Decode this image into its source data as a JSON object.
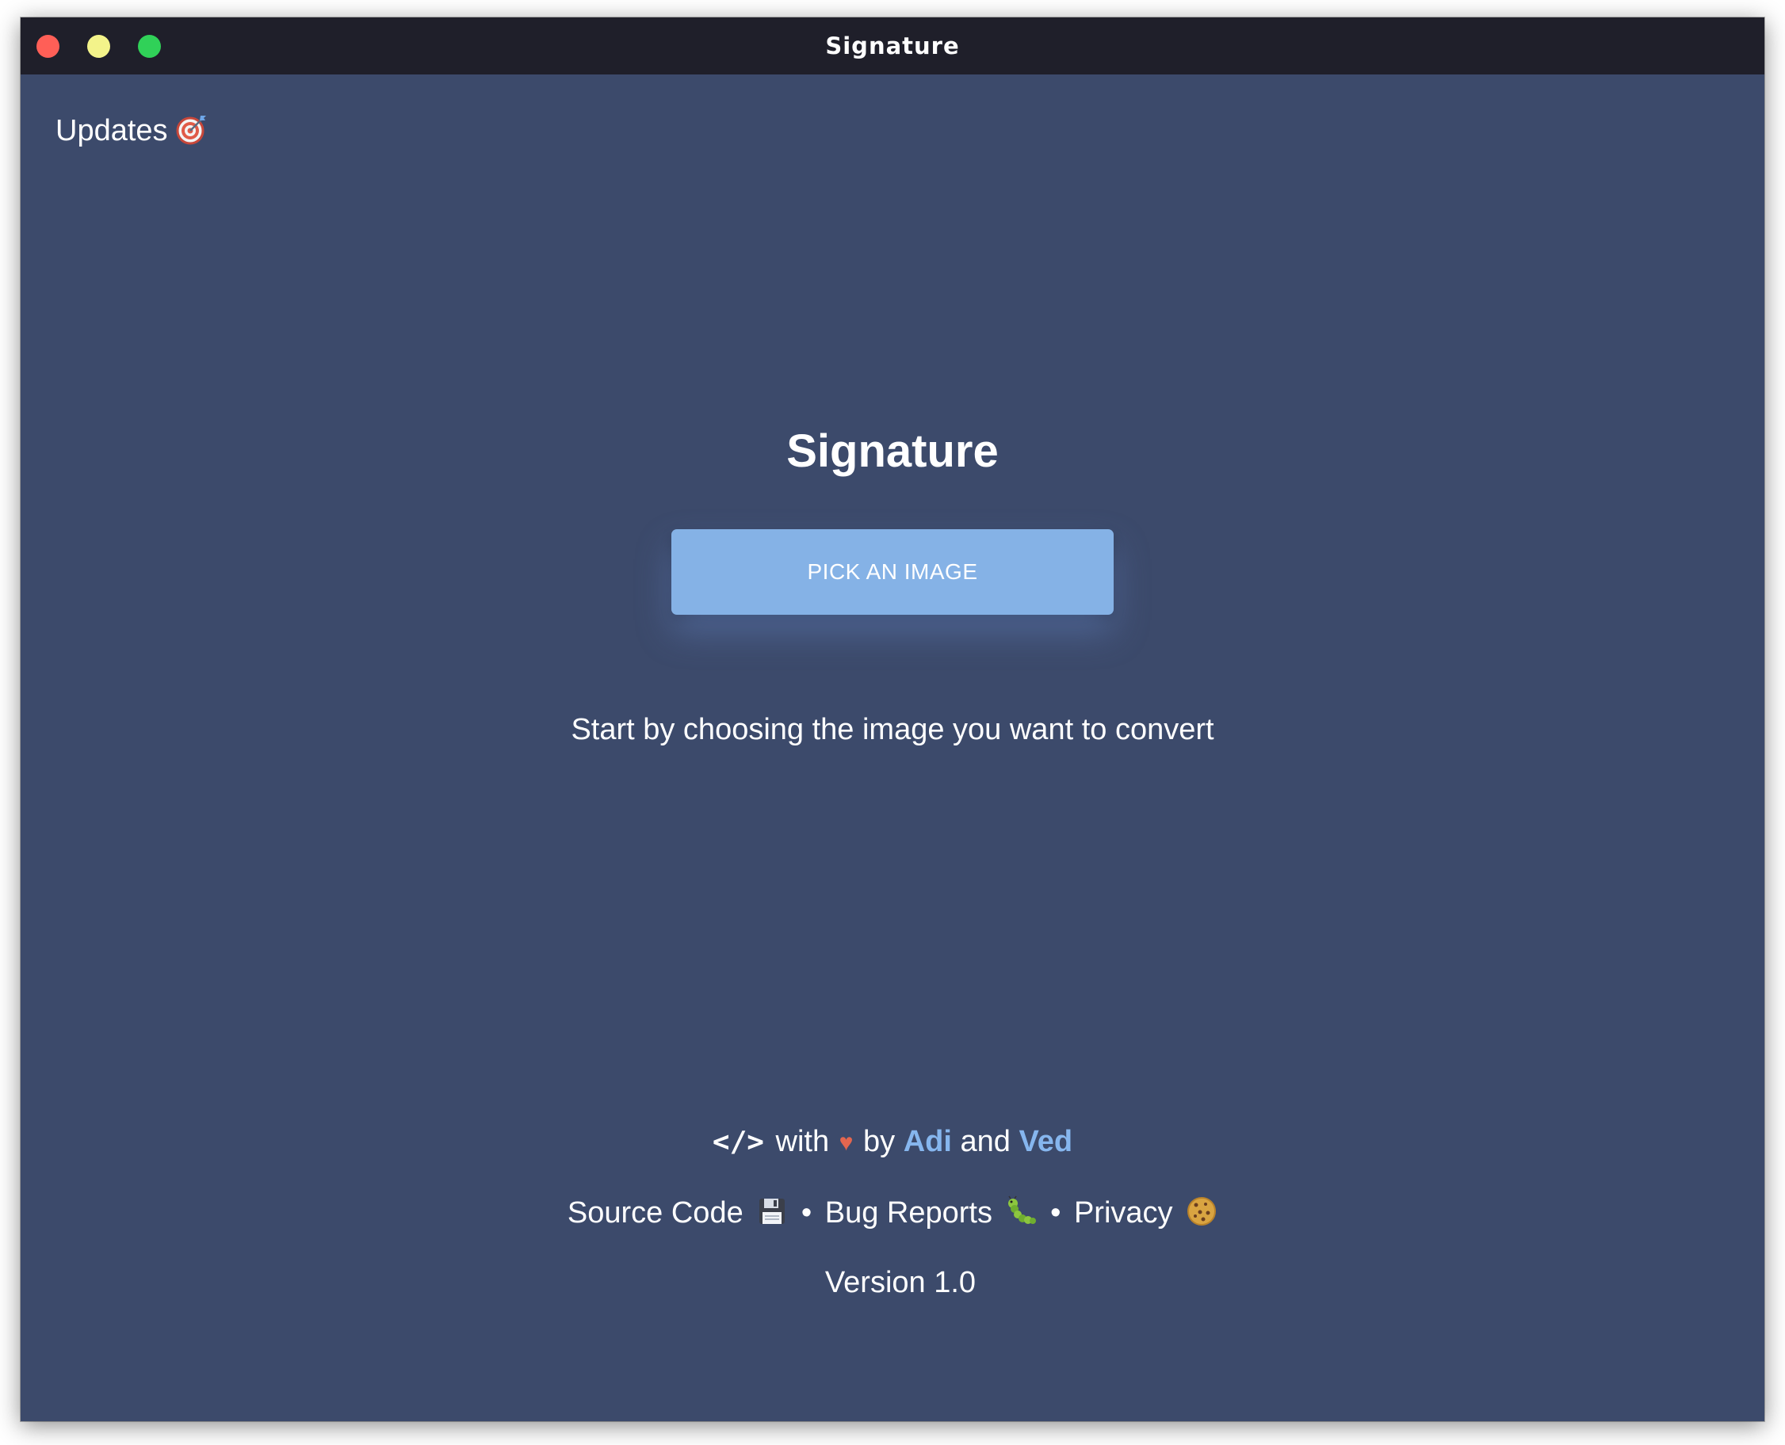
{
  "window": {
    "title": "Signature",
    "background_color": "#3c4a6b",
    "titlebar_color": "#1f1f2a",
    "traffic_lights": {
      "close_color": "#ff5f57",
      "minimize_color": "#f3f38a",
      "maximize_color": "#30d158"
    }
  },
  "header": {
    "updates_label": "Updates",
    "updates_icon": "direct-hit-icon"
  },
  "main": {
    "heading": "Signature",
    "pick_button_label": "PICK AN IMAGE",
    "pick_button_color": "#85b2e6",
    "instruction": "Start by choosing the image you want to convert"
  },
  "footer": {
    "code_symbol": "</>",
    "with_text": "with",
    "heart_symbol": "♥",
    "by_text": "by",
    "author1": "Adi",
    "and_text": "and",
    "author2": "Ved",
    "author_color": "#86b6ee",
    "links": {
      "source_code": "Source Code",
      "source_code_icon": "floppy-disk-icon",
      "bug_reports": "Bug Reports",
      "bug_reports_icon": "bug-icon",
      "privacy": "Privacy",
      "privacy_icon": "cookie-icon",
      "separator": "•"
    },
    "version": "Version 1.0"
  }
}
